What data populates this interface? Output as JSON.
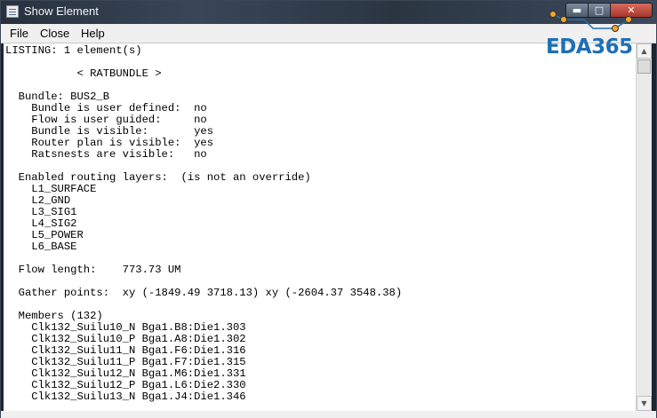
{
  "window": {
    "title": "Show Element"
  },
  "titlebar": {
    "min_glyph": "▬",
    "max_glyph": "□",
    "close_glyph": "✕"
  },
  "menu": [
    "File",
    "Close",
    "Help"
  ],
  "watermark": {
    "text": "EDA365"
  },
  "listing": [
    "LISTING: 1 element(s)",
    "",
    "           < RATBUNDLE >",
    "",
    "  Bundle: BUS2_B",
    "    Bundle is user defined:  no",
    "    Flow is user guided:     no",
    "    Bundle is visible:       yes",
    "    Router plan is visible:  yes",
    "    Ratsnests are visible:   no",
    "",
    "  Enabled routing layers:  (is not an override)",
    "    L1_SURFACE",
    "    L2_GND",
    "    L3_SIG1",
    "    L4_SIG2",
    "    L5_POWER",
    "    L6_BASE",
    "",
    "  Flow length:    773.73 UM",
    "",
    "  Gather points:  xy (-1849.49 3718.13) xy (-2604.37 3548.38)",
    "",
    "  Members (132)",
    "    Clk132_Suilu10_N Bga1.B8:Die1.303",
    "    Clk132_Suilu10_P Bga1.A8:Die1.302",
    "    Clk132_Suilu11_N Bga1.F6:Die1.316",
    "    Clk132_Suilu11_P Bga1.F7:Die1.315",
    "    Clk132_Suilu12_N Bga1.M6:Die1.331",
    "    Clk132_Suilu12_P Bga1.L6:Die2.330",
    "    Clk132_Suilu13_N Bga1.J4:Die1.346"
  ],
  "scrollbar": {
    "up_glyph": "▲",
    "down_glyph": "▼"
  }
}
